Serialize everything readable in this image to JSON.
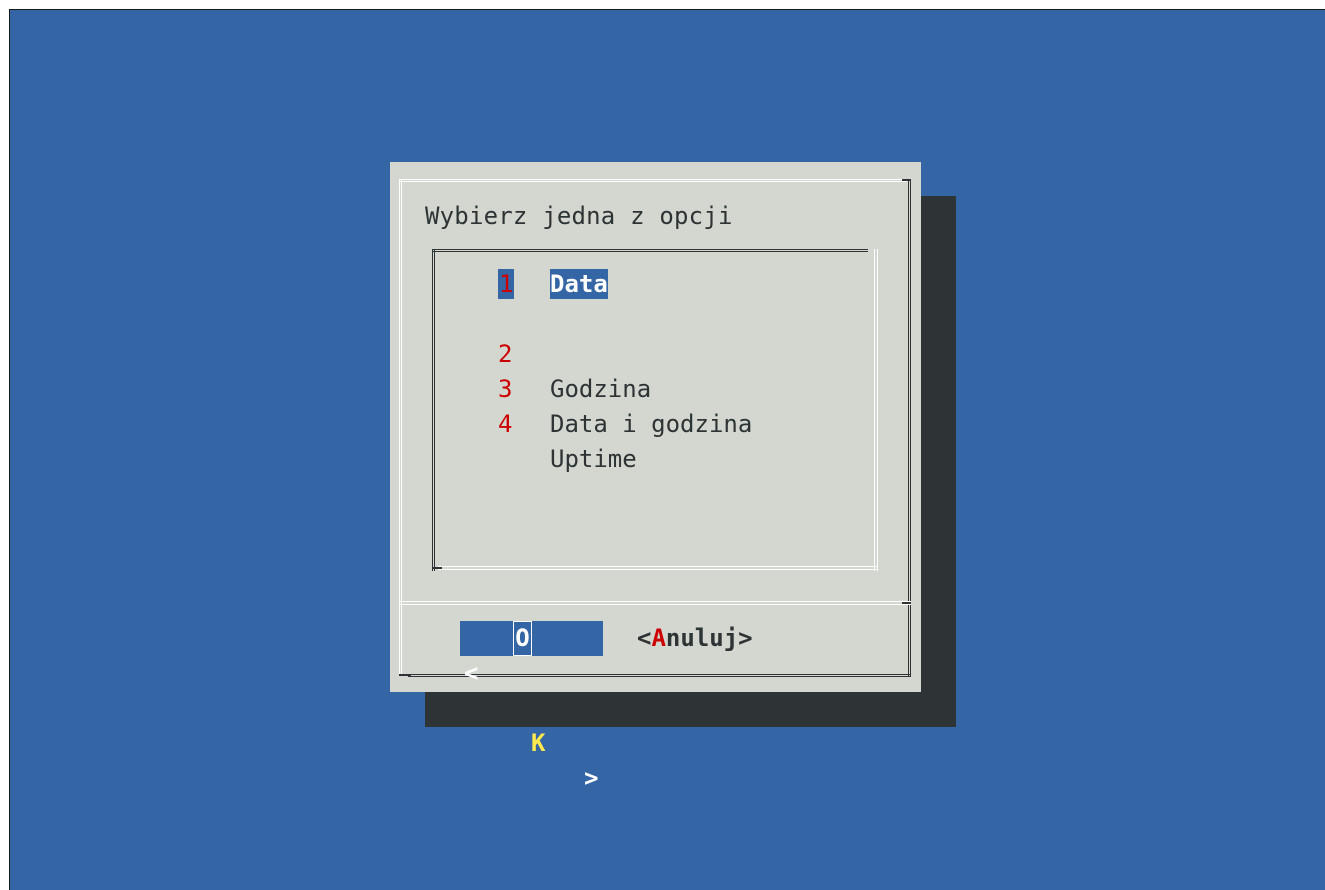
{
  "dialog": {
    "title": "Wybierz jedna z opcji",
    "menu": [
      {
        "tag": "1",
        "label": "Data",
        "selected": true
      },
      {
        "tag": "2",
        "label": "Godzina",
        "selected": false
      },
      {
        "tag": "3",
        "label": "Data i godzina",
        "selected": false
      },
      {
        "tag": "4",
        "label": "Uptime",
        "selected": false
      }
    ],
    "buttons": {
      "ok": {
        "left": "<",
        "hotkey_first": "O",
        "hotkey": "K",
        "right": ">"
      },
      "cancel": {
        "open": "<",
        "hotkey": "A",
        "rest": "nuluj",
        "close": ">"
      }
    }
  },
  "colors": {
    "background": "#3465a4",
    "dialog": "#d3d7cf",
    "shadow": "#2e3436",
    "highlight": "#3465a4",
    "tag": "#cc0000",
    "hotkey": "#fce94f"
  }
}
